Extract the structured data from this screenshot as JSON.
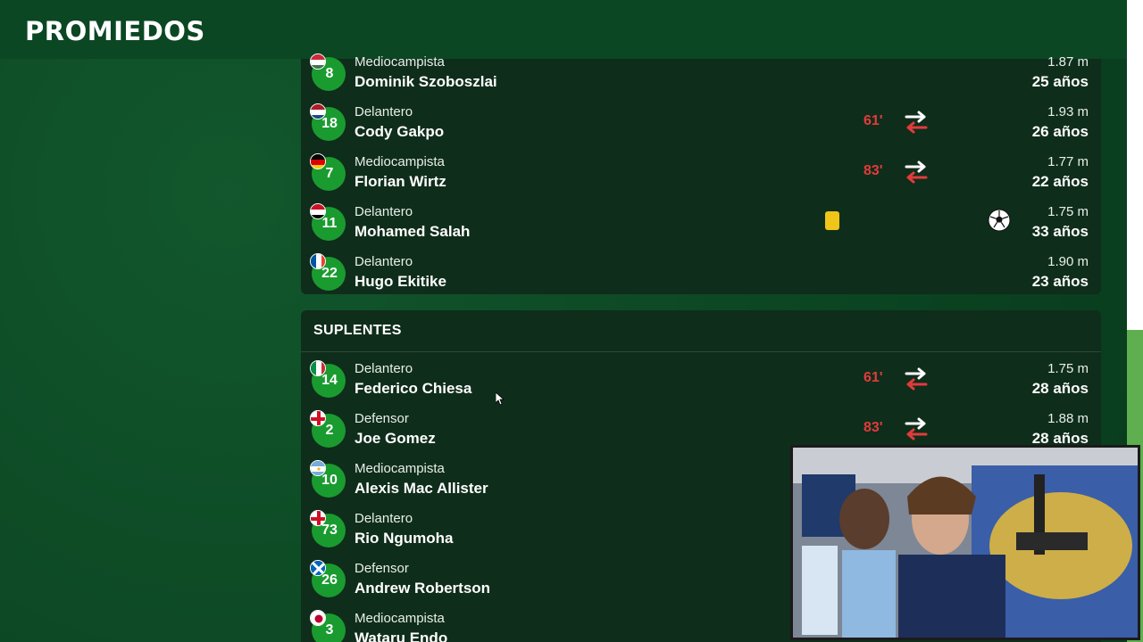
{
  "header": {
    "logo_text": "PROMIEDOS"
  },
  "starters": [
    {
      "number": "8",
      "position": "Mediocampista",
      "name": "Dominik Szoboszlai",
      "height": "1.87 m",
      "age": "25 años",
      "flag": "hungary",
      "sub_minute": "",
      "swap": false,
      "yellow_card": false,
      "goal": false
    },
    {
      "number": "18",
      "position": "Delantero",
      "name": "Cody Gakpo",
      "height": "1.93 m",
      "age": "26 años",
      "flag": "netherlands",
      "sub_minute": "61'",
      "swap": true,
      "yellow_card": false,
      "goal": false
    },
    {
      "number": "7",
      "position": "Mediocampista",
      "name": "Florian Wirtz",
      "height": "1.77 m",
      "age": "22 años",
      "flag": "germany",
      "sub_minute": "83'",
      "swap": true,
      "yellow_card": false,
      "goal": false
    },
    {
      "number": "11",
      "position": "Delantero",
      "name": "Mohamed Salah",
      "height": "1.75 m",
      "age": "33 años",
      "flag": "egypt",
      "sub_minute": "",
      "swap": false,
      "yellow_card": true,
      "goal": true
    },
    {
      "number": "22",
      "position": "Delantero",
      "name": "Hugo Ekitike",
      "height": "1.90 m",
      "age": "23 años",
      "flag": "france",
      "sub_minute": "",
      "swap": false,
      "yellow_card": false,
      "goal": false
    }
  ],
  "subs_title": "SUPLENTES",
  "subs": [
    {
      "number": "14",
      "position": "Delantero",
      "name": "Federico Chiesa",
      "height": "1.75 m",
      "age": "28 años",
      "flag": "italy",
      "sub_minute": "61'",
      "swap": true
    },
    {
      "number": "2",
      "position": "Defensor",
      "name": "Joe Gomez",
      "height": "1.88 m",
      "age": "28 años",
      "flag": "england",
      "sub_minute": "83'",
      "swap": true
    },
    {
      "number": "10",
      "position": "Mediocampista",
      "name": "Alexis Mac Allister",
      "height": "",
      "age": "",
      "flag": "argentina",
      "sub_minute": "",
      "swap": false
    },
    {
      "number": "73",
      "position": "Delantero",
      "name": "Rio Ngumoha",
      "height": "",
      "age": "",
      "flag": "england",
      "sub_minute": "",
      "swap": false
    },
    {
      "number": "26",
      "position": "Defensor",
      "name": "Andrew Robertson",
      "height": "",
      "age": "",
      "flag": "scotland",
      "sub_minute": "",
      "swap": false
    },
    {
      "number": "3",
      "position": "Mediocampista",
      "name": "Wataru Endo",
      "height": "",
      "age": "",
      "flag": "japan",
      "sub_minute": "",
      "swap": false
    }
  ],
  "colors": {
    "accent": "#1a9b2f",
    "sub_minute": "#e23b3b",
    "card_bg": "#0f2d1b",
    "yellow_card": "#f0c419"
  },
  "icons": {
    "swap": "swap-arrows-icon",
    "goal": "soccer-ball-icon",
    "yellow": "yellow-card-icon"
  }
}
